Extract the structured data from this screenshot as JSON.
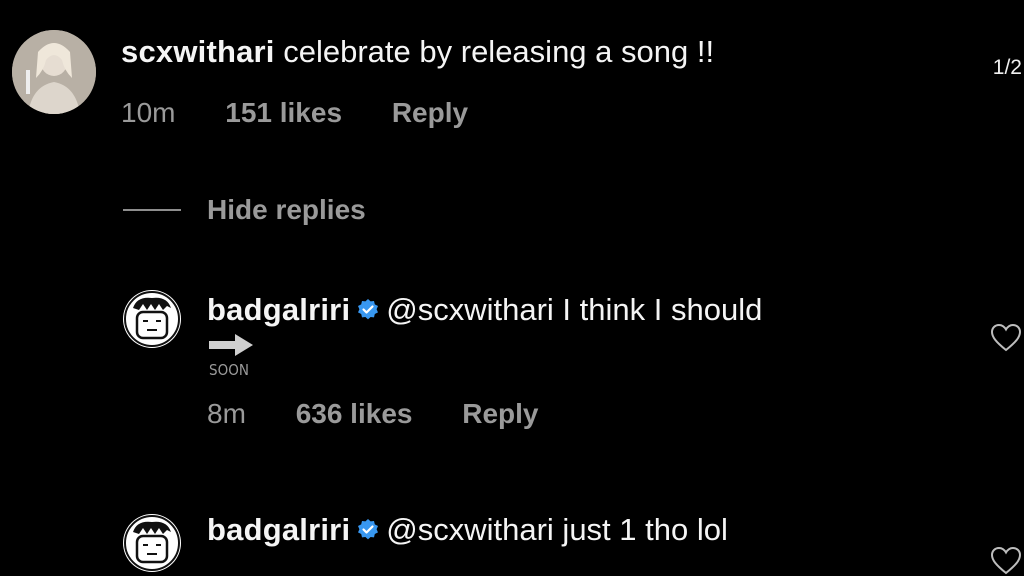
{
  "page_indicator": "1/2",
  "comment": {
    "username": "scxwithari",
    "text": "celebrate by releasing a song !!",
    "time": "10m",
    "likes": "151 likes",
    "reply": "Reply"
  },
  "hide_replies": "Hide replies",
  "replies": [
    {
      "username": "badgalriri",
      "text": "@scxwithari I think I should",
      "sticker_text": "SOON",
      "time": "8m",
      "likes": "636 likes",
      "reply": "Reply"
    },
    {
      "username": "badgalriri",
      "text": "@scxwithari just 1 tho lol"
    }
  ],
  "colors": {
    "background": "#000000",
    "muted": "#9a9a9a",
    "verified": "#3897f0"
  },
  "icons": [
    "verified-badge-icon",
    "heart-icon",
    "arrow-icon"
  ]
}
